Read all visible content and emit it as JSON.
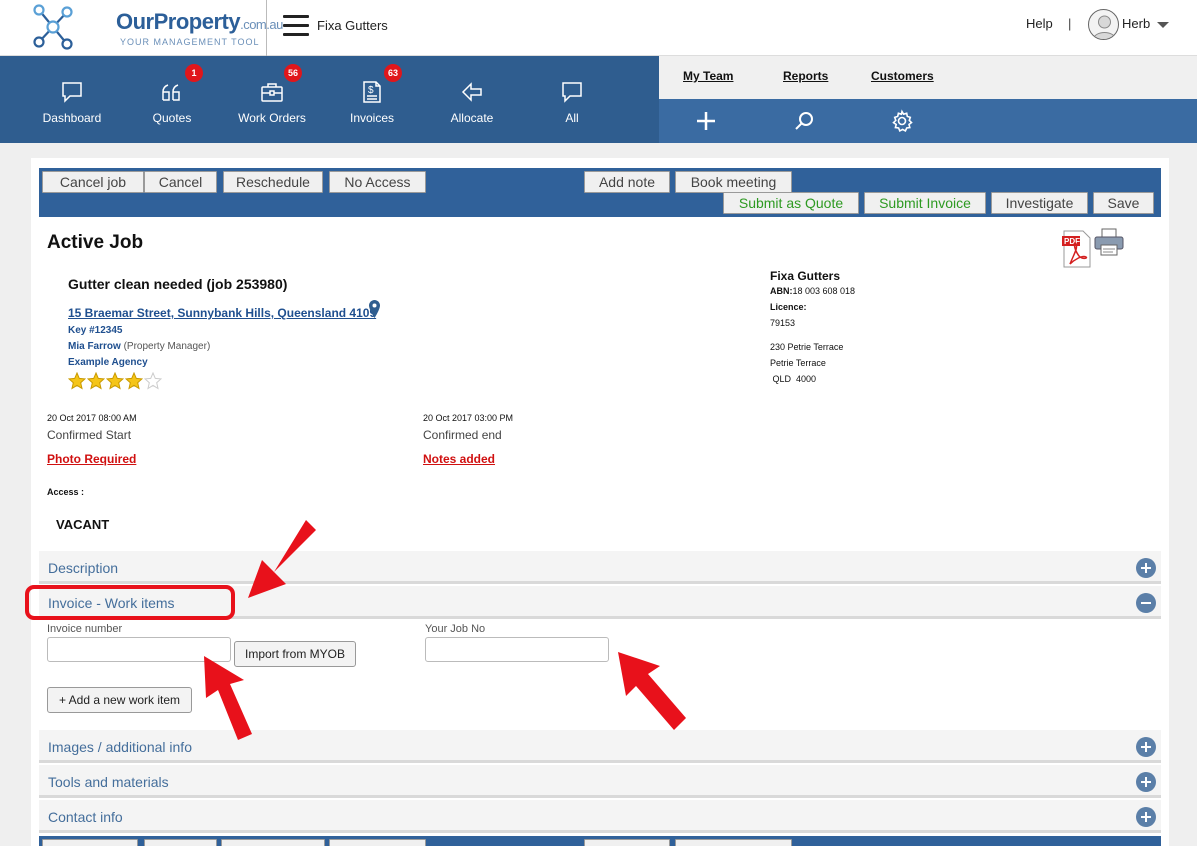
{
  "header": {
    "logo_main": "OurProperty",
    "logo_domain": ".com.au",
    "logo_tagline": "YOUR MANAGEMENT TOOL",
    "company": "Fixa Gutters",
    "help": "Help",
    "separator": "|",
    "user": "Herb"
  },
  "nav": {
    "items": [
      {
        "label": "Dashboard",
        "icon": "chat-bubble-icon",
        "badge": ""
      },
      {
        "label": "Quotes",
        "icon": "quote-marks-icon",
        "badge": "1"
      },
      {
        "label": "Work Orders",
        "icon": "briefcase-icon",
        "badge": "56"
      },
      {
        "label": "Invoices",
        "icon": "invoice-icon",
        "badge": "63"
      },
      {
        "label": "Allocate",
        "icon": "arrow-left-icon",
        "badge": ""
      },
      {
        "label": "All",
        "icon": "chat-bubble-icon",
        "badge": ""
      }
    ],
    "links": [
      "My Team",
      "Reports",
      "Customers"
    ],
    "tool_icons": [
      "plus-icon",
      "search-icon",
      "gear-icon"
    ]
  },
  "actions": {
    "cancel_job": "Cancel job",
    "cancel": "Cancel",
    "reschedule": "Reschedule",
    "no_access": "No Access",
    "add_note": "Add note",
    "book_meeting": "Book meeting",
    "submit_quote": "Submit as Quote",
    "submit_invoice": "Submit Invoice",
    "investigate": "Investigate",
    "save": "Save"
  },
  "job": {
    "heading": "Active Job",
    "title": "Gutter clean needed (job 253980)",
    "address": "15 Braemar Street, Sunnybank Hills, Queensland 4109",
    "key": "Key #12345",
    "manager": "Mia Farrow",
    "manager_role": "(Property Manager)",
    "agency": "Example Agency",
    "rating": 4,
    "rating_max": 5,
    "start_datetime": "20 Oct 2017 08:00 AM",
    "start_label": "Confirmed Start",
    "end_datetime": "20 Oct 2017 03:00 PM",
    "end_label": "Confirmed end",
    "photo_required": "Photo Required",
    "notes_added": "Notes added",
    "access_label": "Access :",
    "access_value": "VACANT"
  },
  "company": {
    "name": "Fixa Gutters",
    "abn_label": "ABN:",
    "abn": "18 003 608 018",
    "licence_label": "Licence:",
    "licence": "79153",
    "addr1": "230 Petrie Terrace",
    "addr2": "Petrie Terrace",
    "addr3": " QLD  4000"
  },
  "sections": {
    "description": "Description",
    "invoice": "Invoice - Work items",
    "images": "Images / additional info",
    "tools": "Tools and materials",
    "contact": "Contact info"
  },
  "invoice_form": {
    "invoice_number_label": "Invoice number",
    "invoice_number_value": "",
    "import_button": "Import from MYOB",
    "job_no_label": "Your Job No",
    "job_no_value": "",
    "add_item_button": "+ Add a new work item"
  },
  "colors": {
    "nav_bg": "#2f5d8f",
    "actionbar_bg": "#30619a",
    "badge": "#e0161b",
    "annotation": "#e8111b",
    "green_text": "#2e9a22"
  }
}
